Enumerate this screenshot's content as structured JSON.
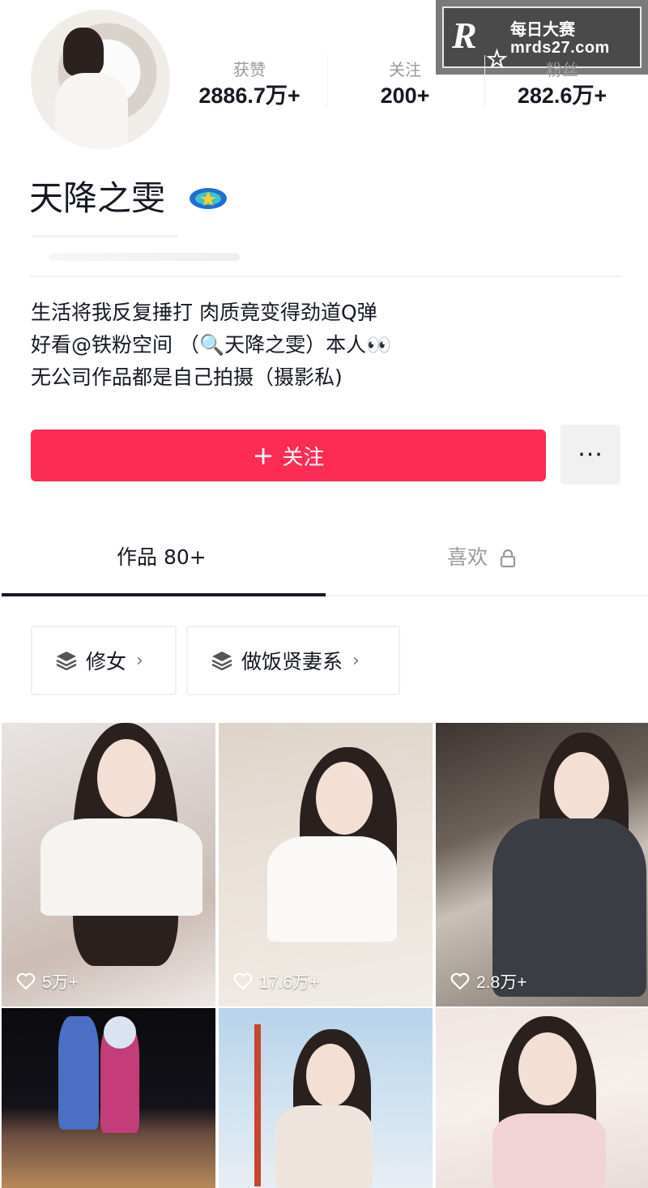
{
  "watermark": {
    "title": "每日大赛",
    "url": "mrds27.com",
    "logo_letter": "R"
  },
  "profile": {
    "stats": [
      {
        "label": "获赞",
        "value": "2886.7万+"
      },
      {
        "label": "关注",
        "value": "200+"
      },
      {
        "label": "粉丝",
        "value": "282.6万+"
      }
    ],
    "nickname": "天降之雯",
    "bio": [
      "生活将我反复捶打 肉质竟变得劲道Q弹",
      "好看@铁粉空间 （🔍天降之雯）本人👀",
      "无公司作品都是自己拍摄（摄影私)"
    ]
  },
  "actions": {
    "follow_label": "关注",
    "follow_icon": "plus-icon",
    "more_label": "···"
  },
  "tabs": [
    {
      "label": "作品 80+",
      "active": true
    },
    {
      "label": "喜欢",
      "active": false,
      "icon": "lock-icon"
    }
  ],
  "collections": [
    {
      "label": "修女",
      "icon": "layers-icon"
    },
    {
      "label": "做饭贤妻系",
      "icon": "layers-icon"
    }
  ],
  "videos": [
    {
      "likes": "5万+"
    },
    {
      "likes": "17.6万+"
    },
    {
      "likes": "2.8万+"
    },
    {
      "likes": ""
    },
    {
      "likes": ""
    },
    {
      "likes": ""
    }
  ],
  "colors": {
    "accent": "#fe2c55",
    "text": "#161823",
    "muted": "#9a9a9a"
  }
}
